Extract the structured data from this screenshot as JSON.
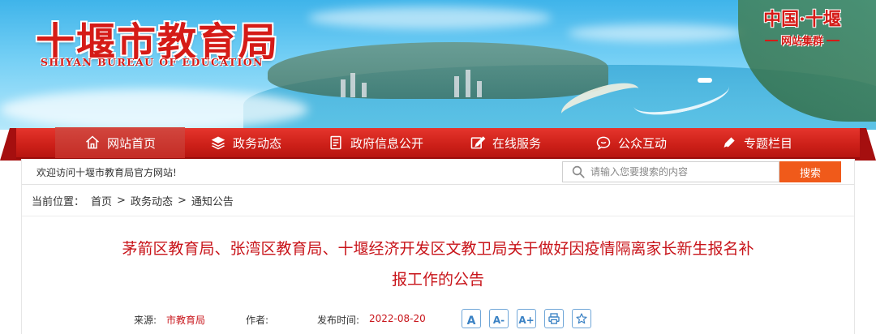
{
  "header": {
    "title": "十堰市教育局",
    "subtitle": "SHIYAN BUREAU OF EDUCATION",
    "group_logo_top": "中国·十堰",
    "group_logo_bottom": "网站集群"
  },
  "nav": {
    "items": [
      {
        "label": "网站首页",
        "icon": "home-icon",
        "active": true
      },
      {
        "label": "政务动态",
        "icon": "layers-icon",
        "active": false
      },
      {
        "label": "政府信息公开",
        "icon": "document-icon",
        "active": false
      },
      {
        "label": "在线服务",
        "icon": "edit-icon",
        "active": false
      },
      {
        "label": "公众互动",
        "icon": "chat-icon",
        "active": false
      },
      {
        "label": "专题栏目",
        "icon": "pen-icon",
        "active": false
      }
    ]
  },
  "topbar": {
    "welcome": "欢迎访问十堰市教育局官方网站!",
    "search_placeholder": "请输入您要搜索的内容",
    "search_button": "搜索"
  },
  "breadcrumb": {
    "label": "当前位置：",
    "items": [
      "首页",
      "政务动态",
      "通知公告"
    ],
    "separator": ">"
  },
  "article": {
    "title_line1": "茅箭区教育局、张湾区教育局、十堰经济开发区文教卫局关于做好因疫情隔离家长新生报名补",
    "title_line2": "报工作的公告"
  },
  "meta": {
    "source_label": "来源:",
    "source_value": "市教育局",
    "author_label": "作者:",
    "author_value": "",
    "date_label": "发布时间:",
    "date_value": "2022-08-20",
    "tools": [
      {
        "label": "A",
        "icon": "font-normal-icon"
      },
      {
        "label": "A-",
        "icon": "font-decrease-icon"
      },
      {
        "label": "A+",
        "icon": "font-increase-icon"
      },
      {
        "label": "",
        "icon": "print-icon"
      },
      {
        "label": "",
        "icon": "star-icon"
      }
    ]
  },
  "colors": {
    "brand_red": "#d51b17",
    "nav_red": "#cc1f18",
    "search_orange": "#f05a1a",
    "title_red": "#c8141a",
    "tool_blue": "#3b82c4"
  }
}
